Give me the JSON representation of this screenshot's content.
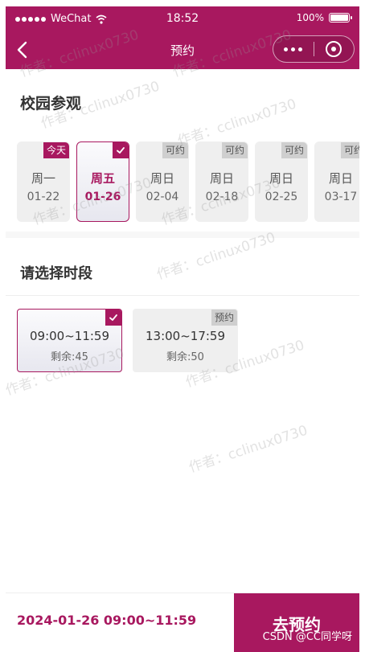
{
  "status": {
    "carrier": "WeChat",
    "time": "18:52",
    "battery": "100%"
  },
  "nav": {
    "title": "预约"
  },
  "section_visit": {
    "title": "校园参观",
    "dates": [
      {
        "week": "周一",
        "day": "01-22",
        "badge": "今天",
        "state": "today"
      },
      {
        "week": "周五",
        "day": "01-26",
        "badge": "",
        "state": "selected"
      },
      {
        "week": "周日",
        "day": "02-04",
        "badge": "可约",
        "state": "available"
      },
      {
        "week": "周日",
        "day": "02-18",
        "badge": "可约",
        "state": "available"
      },
      {
        "week": "周日",
        "day": "02-25",
        "badge": "可约",
        "state": "available"
      },
      {
        "week": "周日",
        "day": "03-17",
        "badge": "可约",
        "state": "available"
      }
    ]
  },
  "section_slot": {
    "title": "请选择时段",
    "slots": [
      {
        "range": "09:00~11:59",
        "remain": "剩余:45",
        "badge": "",
        "state": "selected"
      },
      {
        "range": "13:00~17:59",
        "remain": "剩余:50",
        "badge": "预约",
        "state": "available"
      }
    ]
  },
  "bottom": {
    "summary": "2024-01-26 09:00~11:59",
    "go_label": "去预约"
  },
  "watermark": "作者：cclinux0730",
  "credit": "CSDN @CC同学呀",
  "colors": {
    "brand": "#a8185f",
    "card_bg": "#efefef"
  }
}
